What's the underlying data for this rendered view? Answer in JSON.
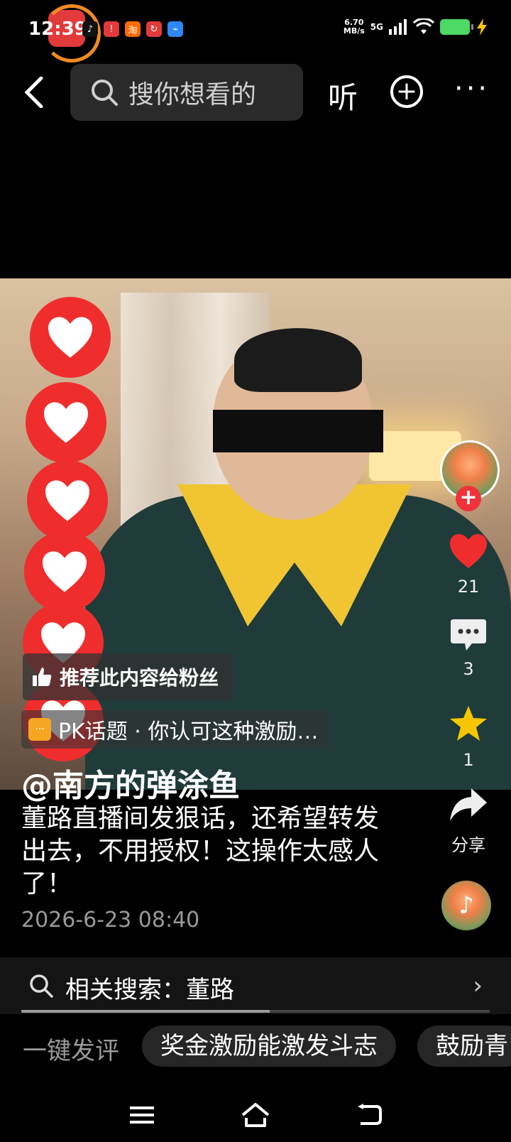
{
  "status_bar": {
    "time": "12:39",
    "app_icons": [
      {
        "name": "tiktok-icon",
        "glyph": "♪",
        "color": "#111111"
      },
      {
        "name": "alert-app-icon",
        "glyph": "!",
        "color": "#e23a3a"
      },
      {
        "name": "taobao-icon",
        "glyph": "淘",
        "color": "#ff6a00"
      },
      {
        "name": "finance-app-icon",
        "glyph": "↻",
        "color": "#e23a3a"
      },
      {
        "name": "browser-app-icon",
        "glyph": "⌁",
        "color": "#2f86f6"
      }
    ],
    "network_speed": "6.70\nMB/s",
    "signal_label": "5G"
  },
  "topbar": {
    "search_placeholder": "搜你想看的",
    "listen_label": "听"
  },
  "video": {
    "recommend_label": "推荐此内容给粉丝",
    "pk_topic": "PK话题 · 你认可这种激励…"
  },
  "post": {
    "author": "@南方的弹涂鱼",
    "description": "董路直播间发狠话，还希望转发出去，不用授权！这操作太感人了！",
    "date": "2026-6-23 08:40"
  },
  "actions": {
    "likes": "21",
    "comments": "3",
    "favorites": "1",
    "share_label": "分享"
  },
  "related_search": {
    "label": "相关搜索：董路"
  },
  "playback": {
    "progress": 0.53
  },
  "quick_comment": {
    "label": "一键发评",
    "chips": [
      "奖金激励能激发斗志",
      "鼓励青"
    ]
  },
  "colors": {
    "accent_red": "#f02d2d",
    "favorite_yellow": "#f7c600"
  }
}
